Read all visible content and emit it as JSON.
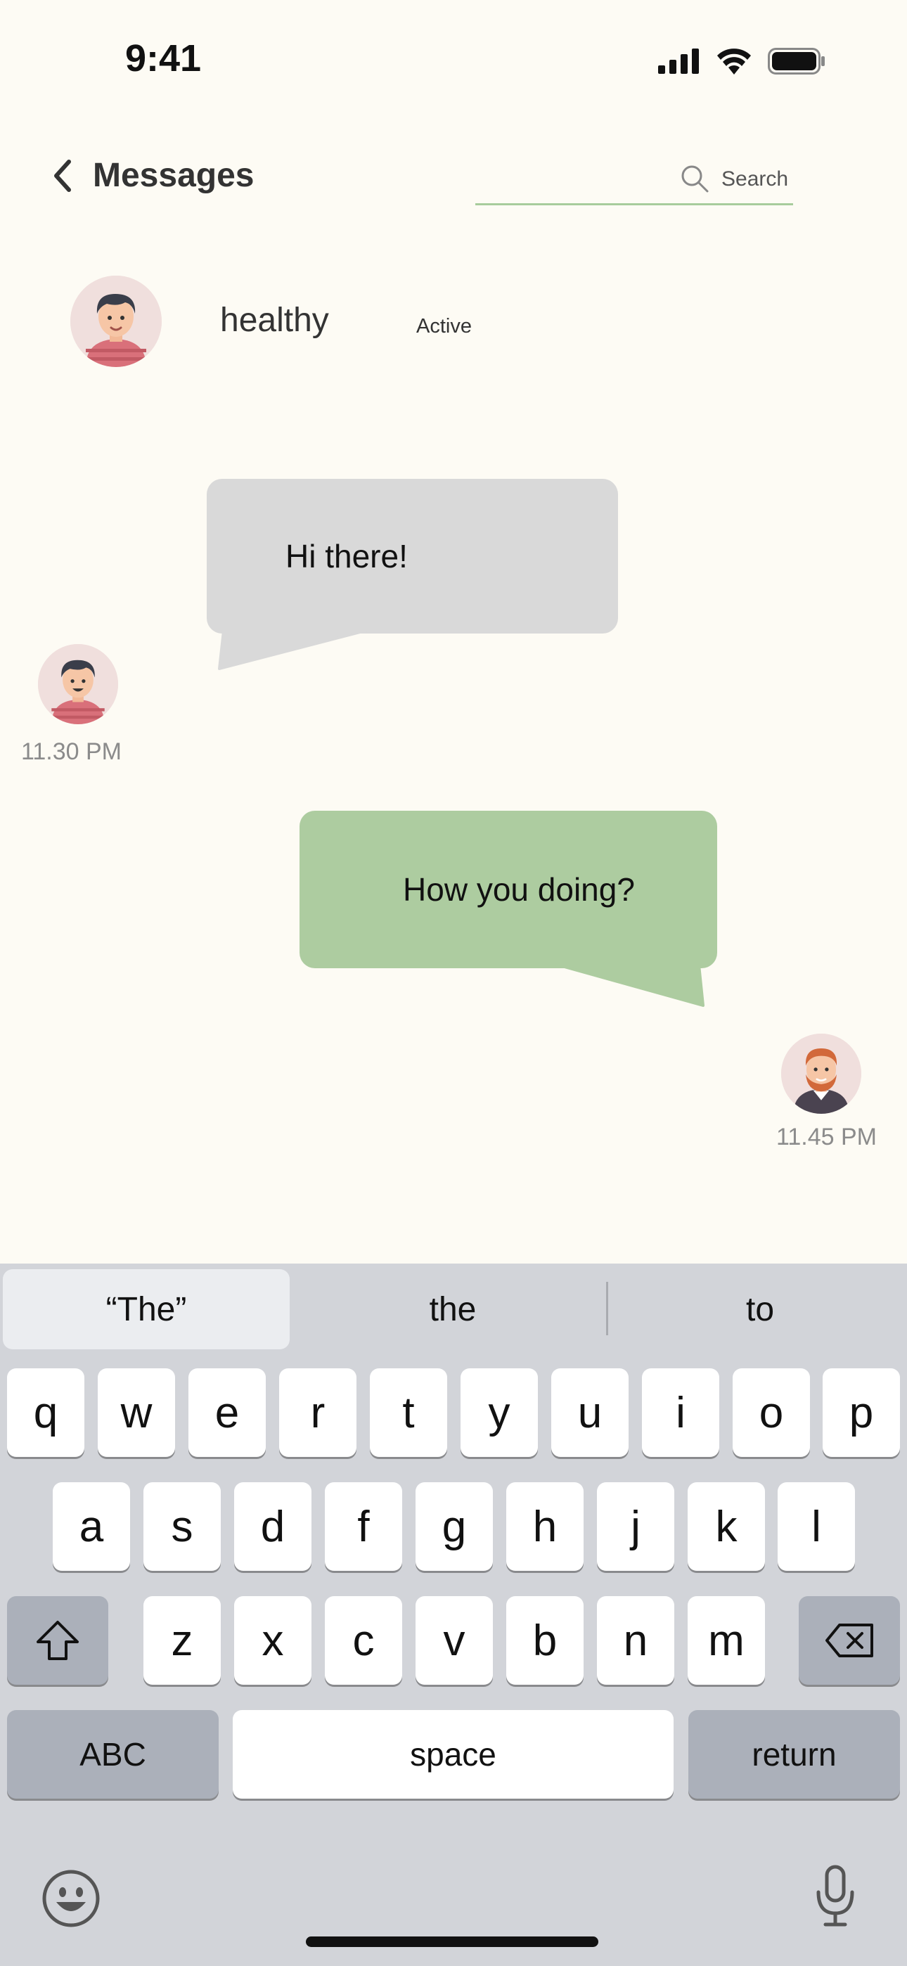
{
  "status_bar": {
    "time": "9:41",
    "icons": [
      "signal-icon",
      "wifi-icon",
      "battery-icon"
    ]
  },
  "header": {
    "back_icon": "chevron-left-icon",
    "title": "Messages",
    "search": {
      "icon": "search-icon",
      "placeholder": "Search"
    }
  },
  "contact": {
    "name": "healthy",
    "status": "Active"
  },
  "messages": [
    {
      "direction": "incoming",
      "text": "Hi there!",
      "time": "11.30 PM",
      "bubble_color": "#d9d9d9"
    },
    {
      "direction": "outgoing",
      "text": "How you doing?",
      "time": "11.45 PM",
      "bubble_color": "#adcca0"
    }
  ],
  "keyboard": {
    "suggestions": [
      "“The”",
      "the",
      "to"
    ],
    "row1": [
      "q",
      "w",
      "e",
      "r",
      "t",
      "y",
      "u",
      "i",
      "o",
      "p"
    ],
    "row2": [
      "a",
      "s",
      "d",
      "f",
      "g",
      "h",
      "j",
      "k",
      "l"
    ],
    "row3": [
      "z",
      "x",
      "c",
      "v",
      "b",
      "n",
      "m"
    ],
    "shift_icon": "shift-icon",
    "delete_icon": "delete-icon",
    "abc_label": "ABC",
    "space_label": "space",
    "return_label": "return",
    "emoji_icon": "emoji-icon",
    "mic_icon": "microphone-icon"
  },
  "colors": {
    "background": "#fdfbf4",
    "accent": "#a7cc9c",
    "keyboard_bg": "#d2d4d9"
  }
}
